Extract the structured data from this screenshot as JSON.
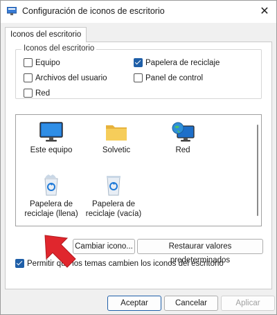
{
  "window": {
    "title": "Configuración de iconos de escritorio",
    "close_glyph": "✕"
  },
  "tab": {
    "label": "Iconos del escritorio"
  },
  "group": {
    "legend": "Iconos del escritorio",
    "checkboxes": [
      {
        "label": "Equipo",
        "checked": false
      },
      {
        "label": "Archivos del usuario",
        "checked": false
      },
      {
        "label": "Red",
        "checked": false
      },
      {
        "label": "Papelera de reciclaje",
        "checked": true
      },
      {
        "label": "Panel de control",
        "checked": false
      }
    ]
  },
  "icons": [
    {
      "line1": "Este equipo",
      "line2": "",
      "icon": "monitor-icon"
    },
    {
      "line1": "Solvetic",
      "line2": "",
      "icon": "folder-icon"
    },
    {
      "line1": "Red",
      "line2": "",
      "icon": "network-globe-icon"
    },
    {
      "line1": "Papelera de",
      "line2": "reciclaje (llena)",
      "icon": "recycle-bin-full-icon"
    },
    {
      "line1": "Papelera de",
      "line2": "reciclaje (vacía)",
      "icon": "recycle-bin-empty-icon"
    }
  ],
  "buttons": {
    "change_icon": "Cambiar icono...",
    "restore_defaults": "Restaurar valores predeterminados",
    "accept": "Aceptar",
    "cancel": "Cancelar",
    "apply": "Aplicar"
  },
  "theme_checkbox": {
    "label": "Permitir que los temas cambien los iconos del escritorio",
    "checked": true
  },
  "colors": {
    "accent": "#1f5fa8",
    "annotation_arrow": "#e0262d"
  }
}
